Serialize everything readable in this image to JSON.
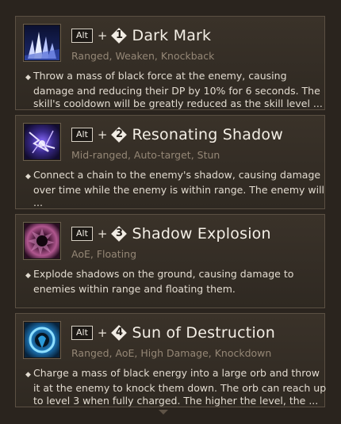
{
  "hotkey": "Alt",
  "plus": "+",
  "bullet": "◆",
  "skills": [
    {
      "number": "1",
      "name": "Dark Mark",
      "tags": "Ranged, Weaken, Knockback",
      "description": "Throw a mass of black force at the enemy, causing damage and reducing their DP by 10% for 6 seconds. The skill's cooldown will be greatly reduced as the skill level ..."
    },
    {
      "number": "2",
      "name": "Resonating Shadow",
      "tags": "Mid-ranged, Auto-target, Stun",
      "description": "Connect a chain to the enemy's shadow, causing damage over time while the enemy is within range. The enemy will ..."
    },
    {
      "number": "3",
      "name": "Shadow Explosion",
      "tags": "AoE, Floating",
      "description": "Explode shadows on the ground, causing damage to enemies within range and floating them."
    },
    {
      "number": "4",
      "name": "Sun of Destruction",
      "tags": "Ranged, AoE, High Damage, Knockdown",
      "description": "Charge a mass of black energy into a large orb and throw it at the enemy to knock them down. The orb can reach up to level 3 when fully charged. The higher the level, the ..."
    }
  ]
}
